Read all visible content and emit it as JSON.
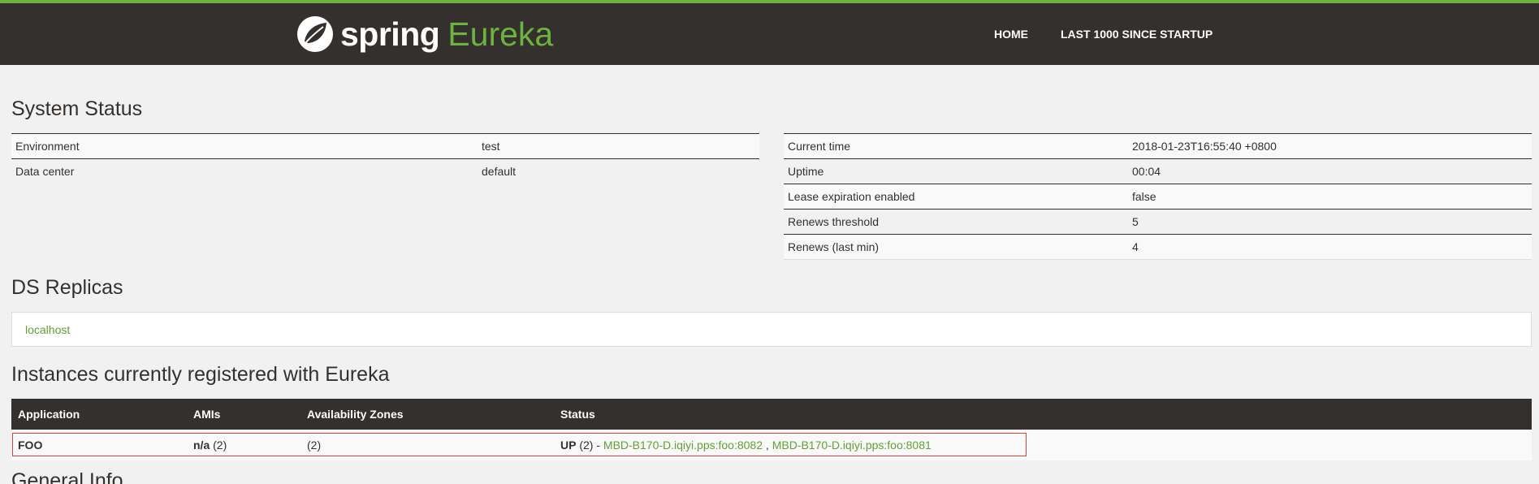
{
  "header": {
    "brand_spring": "spring",
    "brand_eureka": "Eureka",
    "nav": [
      "HOME",
      "LAST 1000 SINCE STARTUP"
    ]
  },
  "system_status": {
    "title": "System Status",
    "left": [
      {
        "key": "Environment",
        "value": "test"
      },
      {
        "key": "Data center",
        "value": "default"
      }
    ],
    "right": [
      {
        "key": "Current time",
        "value": "2018-01-23T16:55:40 +0800"
      },
      {
        "key": "Uptime",
        "value": "00:04"
      },
      {
        "key": "Lease expiration enabled",
        "value": "false"
      },
      {
        "key": "Renews threshold",
        "value": "5"
      },
      {
        "key": "Renews (last min)",
        "value": "4"
      }
    ]
  },
  "replicas": {
    "title": "DS Replicas",
    "items": [
      "localhost"
    ]
  },
  "instances": {
    "title": "Instances currently registered with Eureka",
    "columns": [
      "Application",
      "AMIs",
      "Availability Zones",
      "Status"
    ],
    "rows": [
      {
        "application": "FOO",
        "amis_bold": "n/a",
        "amis_count": " (2)",
        "zones": "(2)",
        "status_bold": "UP",
        "status_count": " (2) - ",
        "instance_1": "MBD-B170-D.iqiyi.pps:foo:8082",
        "separator": " , ",
        "instance_2": "MBD-B170-D.iqiyi.pps:foo:8081"
      }
    ]
  },
  "general_info": {
    "title": "General Info"
  },
  "colors": {
    "brand_green": "#6db33f",
    "navbar_bg": "#34302d",
    "link_green": "#5fa134",
    "highlight_red": "#e0403a"
  }
}
